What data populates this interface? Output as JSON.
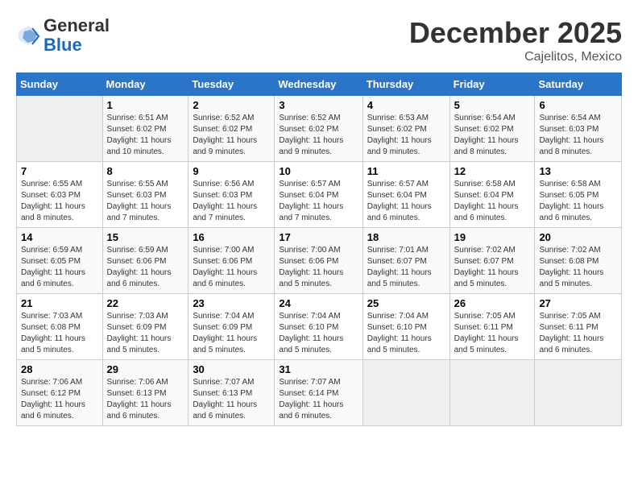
{
  "header": {
    "logo_general": "General",
    "logo_blue": "Blue",
    "month": "December 2025",
    "location": "Cajelitos, Mexico"
  },
  "days_of_week": [
    "Sunday",
    "Monday",
    "Tuesday",
    "Wednesday",
    "Thursday",
    "Friday",
    "Saturday"
  ],
  "weeks": [
    [
      {
        "day": "",
        "empty": true
      },
      {
        "day": "1",
        "sunrise": "Sunrise: 6:51 AM",
        "sunset": "Sunset: 6:02 PM",
        "daylight": "Daylight: 11 hours and 10 minutes."
      },
      {
        "day": "2",
        "sunrise": "Sunrise: 6:52 AM",
        "sunset": "Sunset: 6:02 PM",
        "daylight": "Daylight: 11 hours and 9 minutes."
      },
      {
        "day": "3",
        "sunrise": "Sunrise: 6:52 AM",
        "sunset": "Sunset: 6:02 PM",
        "daylight": "Daylight: 11 hours and 9 minutes."
      },
      {
        "day": "4",
        "sunrise": "Sunrise: 6:53 AM",
        "sunset": "Sunset: 6:02 PM",
        "daylight": "Daylight: 11 hours and 9 minutes."
      },
      {
        "day": "5",
        "sunrise": "Sunrise: 6:54 AM",
        "sunset": "Sunset: 6:02 PM",
        "daylight": "Daylight: 11 hours and 8 minutes."
      },
      {
        "day": "6",
        "sunrise": "Sunrise: 6:54 AM",
        "sunset": "Sunset: 6:03 PM",
        "daylight": "Daylight: 11 hours and 8 minutes."
      }
    ],
    [
      {
        "day": "7",
        "sunrise": "Sunrise: 6:55 AM",
        "sunset": "Sunset: 6:03 PM",
        "daylight": "Daylight: 11 hours and 8 minutes."
      },
      {
        "day": "8",
        "sunrise": "Sunrise: 6:55 AM",
        "sunset": "Sunset: 6:03 PM",
        "daylight": "Daylight: 11 hours and 7 minutes."
      },
      {
        "day": "9",
        "sunrise": "Sunrise: 6:56 AM",
        "sunset": "Sunset: 6:03 PM",
        "daylight": "Daylight: 11 hours and 7 minutes."
      },
      {
        "day": "10",
        "sunrise": "Sunrise: 6:57 AM",
        "sunset": "Sunset: 6:04 PM",
        "daylight": "Daylight: 11 hours and 7 minutes."
      },
      {
        "day": "11",
        "sunrise": "Sunrise: 6:57 AM",
        "sunset": "Sunset: 6:04 PM",
        "daylight": "Daylight: 11 hours and 6 minutes."
      },
      {
        "day": "12",
        "sunrise": "Sunrise: 6:58 AM",
        "sunset": "Sunset: 6:04 PM",
        "daylight": "Daylight: 11 hours and 6 minutes."
      },
      {
        "day": "13",
        "sunrise": "Sunrise: 6:58 AM",
        "sunset": "Sunset: 6:05 PM",
        "daylight": "Daylight: 11 hours and 6 minutes."
      }
    ],
    [
      {
        "day": "14",
        "sunrise": "Sunrise: 6:59 AM",
        "sunset": "Sunset: 6:05 PM",
        "daylight": "Daylight: 11 hours and 6 minutes."
      },
      {
        "day": "15",
        "sunrise": "Sunrise: 6:59 AM",
        "sunset": "Sunset: 6:06 PM",
        "daylight": "Daylight: 11 hours and 6 minutes."
      },
      {
        "day": "16",
        "sunrise": "Sunrise: 7:00 AM",
        "sunset": "Sunset: 6:06 PM",
        "daylight": "Daylight: 11 hours and 6 minutes."
      },
      {
        "day": "17",
        "sunrise": "Sunrise: 7:00 AM",
        "sunset": "Sunset: 6:06 PM",
        "daylight": "Daylight: 11 hours and 5 minutes."
      },
      {
        "day": "18",
        "sunrise": "Sunrise: 7:01 AM",
        "sunset": "Sunset: 6:07 PM",
        "daylight": "Daylight: 11 hours and 5 minutes."
      },
      {
        "day": "19",
        "sunrise": "Sunrise: 7:02 AM",
        "sunset": "Sunset: 6:07 PM",
        "daylight": "Daylight: 11 hours and 5 minutes."
      },
      {
        "day": "20",
        "sunrise": "Sunrise: 7:02 AM",
        "sunset": "Sunset: 6:08 PM",
        "daylight": "Daylight: 11 hours and 5 minutes."
      }
    ],
    [
      {
        "day": "21",
        "sunrise": "Sunrise: 7:03 AM",
        "sunset": "Sunset: 6:08 PM",
        "daylight": "Daylight: 11 hours and 5 minutes."
      },
      {
        "day": "22",
        "sunrise": "Sunrise: 7:03 AM",
        "sunset": "Sunset: 6:09 PM",
        "daylight": "Daylight: 11 hours and 5 minutes."
      },
      {
        "day": "23",
        "sunrise": "Sunrise: 7:04 AM",
        "sunset": "Sunset: 6:09 PM",
        "daylight": "Daylight: 11 hours and 5 minutes."
      },
      {
        "day": "24",
        "sunrise": "Sunrise: 7:04 AM",
        "sunset": "Sunset: 6:10 PM",
        "daylight": "Daylight: 11 hours and 5 minutes."
      },
      {
        "day": "25",
        "sunrise": "Sunrise: 7:04 AM",
        "sunset": "Sunset: 6:10 PM",
        "daylight": "Daylight: 11 hours and 5 minutes."
      },
      {
        "day": "26",
        "sunrise": "Sunrise: 7:05 AM",
        "sunset": "Sunset: 6:11 PM",
        "daylight": "Daylight: 11 hours and 5 minutes."
      },
      {
        "day": "27",
        "sunrise": "Sunrise: 7:05 AM",
        "sunset": "Sunset: 6:11 PM",
        "daylight": "Daylight: 11 hours and 6 minutes."
      }
    ],
    [
      {
        "day": "28",
        "sunrise": "Sunrise: 7:06 AM",
        "sunset": "Sunset: 6:12 PM",
        "daylight": "Daylight: 11 hours and 6 minutes."
      },
      {
        "day": "29",
        "sunrise": "Sunrise: 7:06 AM",
        "sunset": "Sunset: 6:13 PM",
        "daylight": "Daylight: 11 hours and 6 minutes."
      },
      {
        "day": "30",
        "sunrise": "Sunrise: 7:07 AM",
        "sunset": "Sunset: 6:13 PM",
        "daylight": "Daylight: 11 hours and 6 minutes."
      },
      {
        "day": "31",
        "sunrise": "Sunrise: 7:07 AM",
        "sunset": "Sunset: 6:14 PM",
        "daylight": "Daylight: 11 hours and 6 minutes."
      },
      {
        "day": "",
        "empty": true
      },
      {
        "day": "",
        "empty": true
      },
      {
        "day": "",
        "empty": true
      }
    ]
  ]
}
